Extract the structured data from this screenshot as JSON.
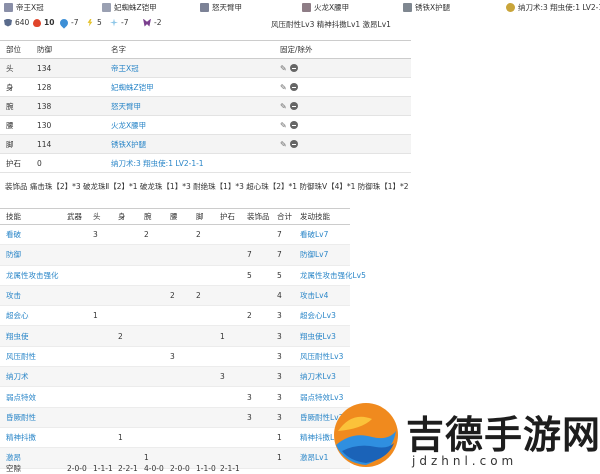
{
  "equip_bar": [
    {
      "name": "帝王X冠",
      "icon": "helmet-icon"
    },
    {
      "name": "妃蜘蛛Z铠甲",
      "icon": "chest-icon"
    },
    {
      "name": "怒天臂甲",
      "icon": "arm-icon"
    },
    {
      "name": "火龙X腰甲",
      "icon": "waist-icon"
    },
    {
      "name": "锈铁X护腿",
      "icon": "leg-icon"
    },
    {
      "name": "纳刀术:3 翔虫使:1 LV2-1-1",
      "icon": "charm-icon"
    }
  ],
  "stats": [
    {
      "icon": "defense-icon",
      "value": "640"
    },
    {
      "icon": "fire-res-icon",
      "value": "10"
    },
    {
      "icon": "water-res-icon",
      "value": "-7"
    },
    {
      "icon": "thunder-res-icon",
      "value": "5"
    },
    {
      "icon": "ice-res-icon",
      "value": "-7"
    },
    {
      "icon": "dragon-res-icon",
      "value": "-2"
    }
  ],
  "skill_summary": "风压耐性Lv3 精神抖擞Lv1 激昂Lv1",
  "equip_table": {
    "headers": [
      "部位",
      "防御",
      "名字",
      "固定/除外"
    ],
    "rows": [
      {
        "part": "头",
        "defense": "134",
        "name": "帝王X冠"
      },
      {
        "part": "身",
        "defense": "128",
        "name": "妃蜘蛛Z铠甲"
      },
      {
        "part": "腕",
        "defense": "138",
        "name": "怒天臂甲"
      },
      {
        "part": "腰",
        "defense": "130",
        "name": "火龙X腰甲"
      },
      {
        "part": "脚",
        "defense": "114",
        "name": "锈铁X护腿"
      },
      {
        "part": "护石",
        "defense": "0",
        "name": "纳刀术:3 翔虫使:1 LV2-1-1"
      }
    ]
  },
  "decorations": "装饰品 痛击珠【2】*3 破龙珠Ⅱ【2】*1 破龙珠【1】*3 耐绝珠【1】*3 超心珠【2】*1 防御珠Ⅴ【4】*1 防御珠【1】*2",
  "skill_table": {
    "headers": [
      "技能",
      "武器",
      "头",
      "身",
      "腕",
      "腰",
      "脚",
      "护石",
      "装饰品",
      "合计",
      "发动技能"
    ],
    "rows": [
      {
        "skill": "看破",
        "weapon": "",
        "head": "3",
        "body": "",
        "arm": "2",
        "waist": "",
        "leg": "2",
        "charm": "",
        "deco": "",
        "total": "7",
        "active": "看破Lv7"
      },
      {
        "skill": "防御",
        "weapon": "",
        "head": "",
        "body": "",
        "arm": "",
        "waist": "",
        "leg": "",
        "charm": "",
        "deco": "7",
        "total": "7",
        "active": "防御Lv7"
      },
      {
        "skill": "龙属性攻击强化",
        "weapon": "",
        "head": "",
        "body": "",
        "arm": "",
        "waist": "",
        "leg": "",
        "charm": "",
        "deco": "5",
        "total": "5",
        "active": "龙属性攻击强化Lv5"
      },
      {
        "skill": "攻击",
        "weapon": "",
        "head": "",
        "body": "",
        "arm": "",
        "waist": "2",
        "leg": "2",
        "charm": "",
        "deco": "",
        "total": "4",
        "active": "攻击Lv4"
      },
      {
        "skill": "超会心",
        "weapon": "",
        "head": "1",
        "body": "",
        "arm": "",
        "waist": "",
        "leg": "",
        "charm": "",
        "deco": "2",
        "total": "3",
        "active": "超会心Lv3"
      },
      {
        "skill": "翔虫使",
        "weapon": "",
        "head": "",
        "body": "2",
        "arm": "",
        "waist": "",
        "leg": "",
        "charm": "1",
        "deco": "",
        "total": "3",
        "active": "翔虫使Lv3"
      },
      {
        "skill": "风压耐性",
        "weapon": "",
        "head": "",
        "body": "",
        "arm": "",
        "waist": "3",
        "leg": "",
        "charm": "",
        "deco": "",
        "total": "3",
        "active": "风压耐性Lv3"
      },
      {
        "skill": "纳刀术",
        "weapon": "",
        "head": "",
        "body": "",
        "arm": "",
        "waist": "",
        "leg": "",
        "charm": "3",
        "deco": "",
        "total": "3",
        "active": "纳刀术Lv3"
      },
      {
        "skill": "弱点特效",
        "weapon": "",
        "head": "",
        "body": "",
        "arm": "",
        "waist": "",
        "leg": "",
        "charm": "",
        "deco": "3",
        "total": "3",
        "active": "弱点特效Lv3"
      },
      {
        "skill": "昏厥耐性",
        "weapon": "",
        "head": "",
        "body": "",
        "arm": "",
        "waist": "",
        "leg": "",
        "charm": "",
        "deco": "3",
        "total": "3",
        "active": "昏厥耐性Lv3"
      },
      {
        "skill": "精神抖擞",
        "weapon": "",
        "head": "",
        "body": "1",
        "arm": "",
        "waist": "",
        "leg": "",
        "charm": "",
        "deco": "",
        "total": "1",
        "active": "精神抖擞Lv1"
      },
      {
        "skill": "激昂",
        "weapon": "",
        "head": "",
        "body": "",
        "arm": "1",
        "waist": "",
        "leg": "",
        "charm": "",
        "deco": "",
        "total": "1",
        "active": "激昂Lv1"
      }
    ],
    "footer": {
      "label": "空隙",
      "weapon": "2-0-0",
      "head": "1-1-1",
      "body": "2-2-1",
      "arm": "4-0-0",
      "waist": "2-0-0",
      "leg": "1-1-0",
      "charm": "2-1-1"
    }
  },
  "watermark": {
    "title": "吉德手游网",
    "url": "jdzhnl.com"
  },
  "colors": {
    "link": "#2a86c8",
    "header_border": "#cccccc",
    "row_alt": "#f4f4f4"
  }
}
